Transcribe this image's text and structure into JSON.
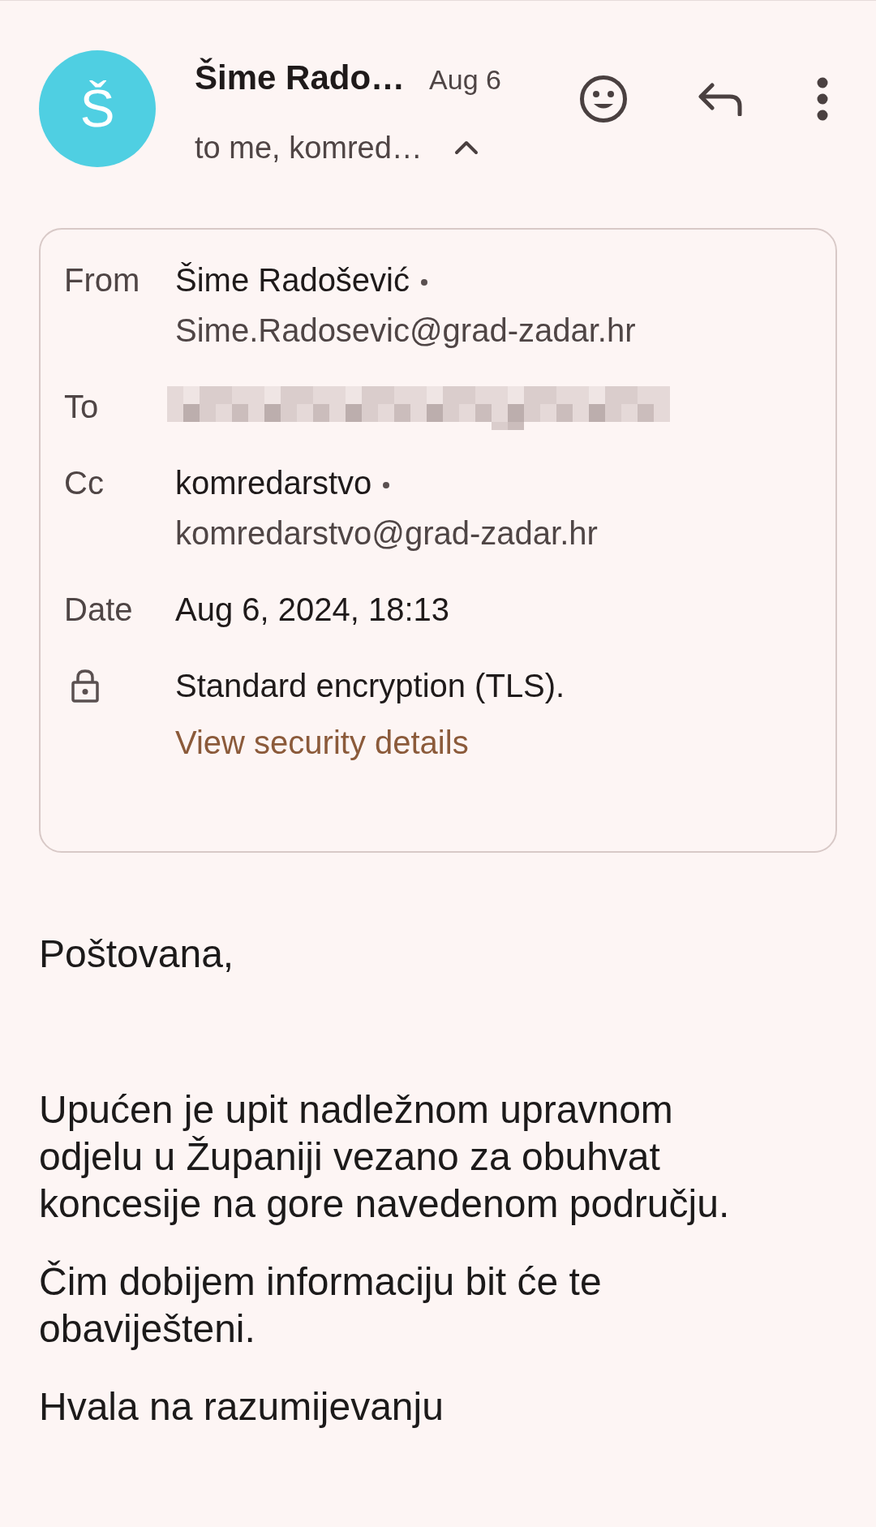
{
  "header": {
    "avatar_letter": "Š",
    "sender": "Šime Rado…",
    "date": "Aug 6",
    "recipients": "to me, komred…",
    "expanded": true
  },
  "details": {
    "rows": [
      {
        "kind": "address",
        "label": "From",
        "name": "Šime Radošević",
        "email": "Sime.Radosevic@grad-zadar.hr"
      },
      {
        "kind": "redacted",
        "label": "To"
      },
      {
        "kind": "address",
        "label": "Cc",
        "name": "komredarstvo",
        "email": "komredarstvo@grad-zadar.hr"
      },
      {
        "kind": "text",
        "label": "Date",
        "value": "Aug 6, 2024, 18:13"
      },
      {
        "kind": "security",
        "value": "Standard encryption (TLS).",
        "link": "View security details"
      }
    ]
  },
  "body": {
    "greeting": "Poštovana,",
    "paragraphs": [
      "Upućen je upit nadležnom upravnom odjelu u Županiji vezano za obuhvat koncesije na gore navedenom području.",
      "Čim dobijem informaciju bit će te obaviješteni.",
      "Hvala na razumijevanju"
    ]
  }
}
